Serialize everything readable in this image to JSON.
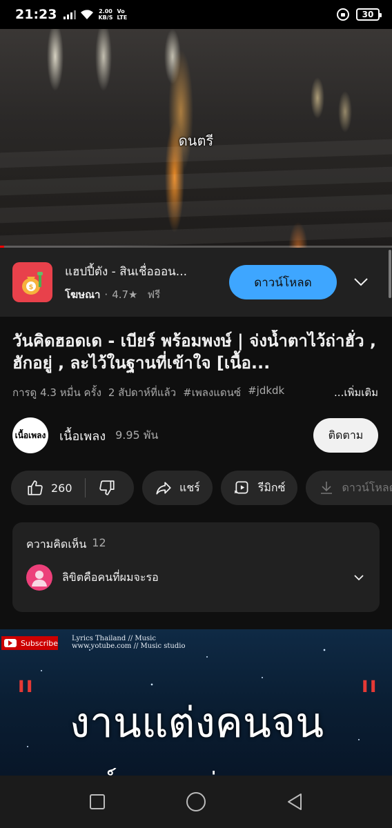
{
  "status_bar": {
    "time": "21:23",
    "speed_value": "2.00",
    "speed_unit": "KB/S",
    "network_vo": "Vo",
    "network_lte": "LTE",
    "battery": "30"
  },
  "video": {
    "caption": "ดนตรี",
    "progress": 0.01,
    "progress_color": "#ff0000"
  },
  "ad": {
    "title": "แฮปปี้ตัง - สินเชื่อออน...",
    "sponsored_label": "โฆษณา",
    "rating": "4.7★",
    "price": "ฟรี",
    "cta_label": "ดาวน์โหลด",
    "cta_color": "#3ea6ff"
  },
  "video_info": {
    "title": "วันคิดฮอดเด - เบียร์ พร้อมพงษ์ | จ่งน้ำตาไว้ถ่าฮั่ว , ฮักอยู่ , ละไว้ในฐานที่เข้าใจ [เนื้อ...",
    "views": "การดู 4.3 หมื่น ครั้ง",
    "age": "2 สัปดาห์ที่แล้ว",
    "tag1": "#เพลงแดนซ์",
    "tag2": "#jdkdk",
    "more_label": "...เพิ่มเติม"
  },
  "channel": {
    "avatar_text": "เนื้อเพลง",
    "name": "เนื้อเพลง",
    "subscribers": "9.95 พัน",
    "subscribe_label": "ติดตาม"
  },
  "actions": {
    "like_count": "260",
    "share_label": "แชร์",
    "remix_label": "รีมิกซ์",
    "download_label": "ดาวน์โหลด"
  },
  "comments": {
    "title": "ความคิดเห็น",
    "count": "12",
    "top_comment": "ลิขิตคือคนที่ผมจะรอ",
    "avatar_color": "#ec407a"
  },
  "next_video": {
    "subscribe_label": "Subscribe",
    "channel_line1": "Lyrics Thailand // Music",
    "channel_line2": "www.yotube.com // Music studio",
    "title_text": "งานแต่งคนจน",
    "open_quote": "\"",
    "close_quote": "\"",
    "subtitle_text": "หนต์แดนแเด่งนจน"
  },
  "icons": {
    "like": "thumbs-up-icon",
    "dislike": "thumbs-down-icon",
    "share": "share-arrow-icon",
    "remix": "remix-icon",
    "download": "download-icon"
  }
}
